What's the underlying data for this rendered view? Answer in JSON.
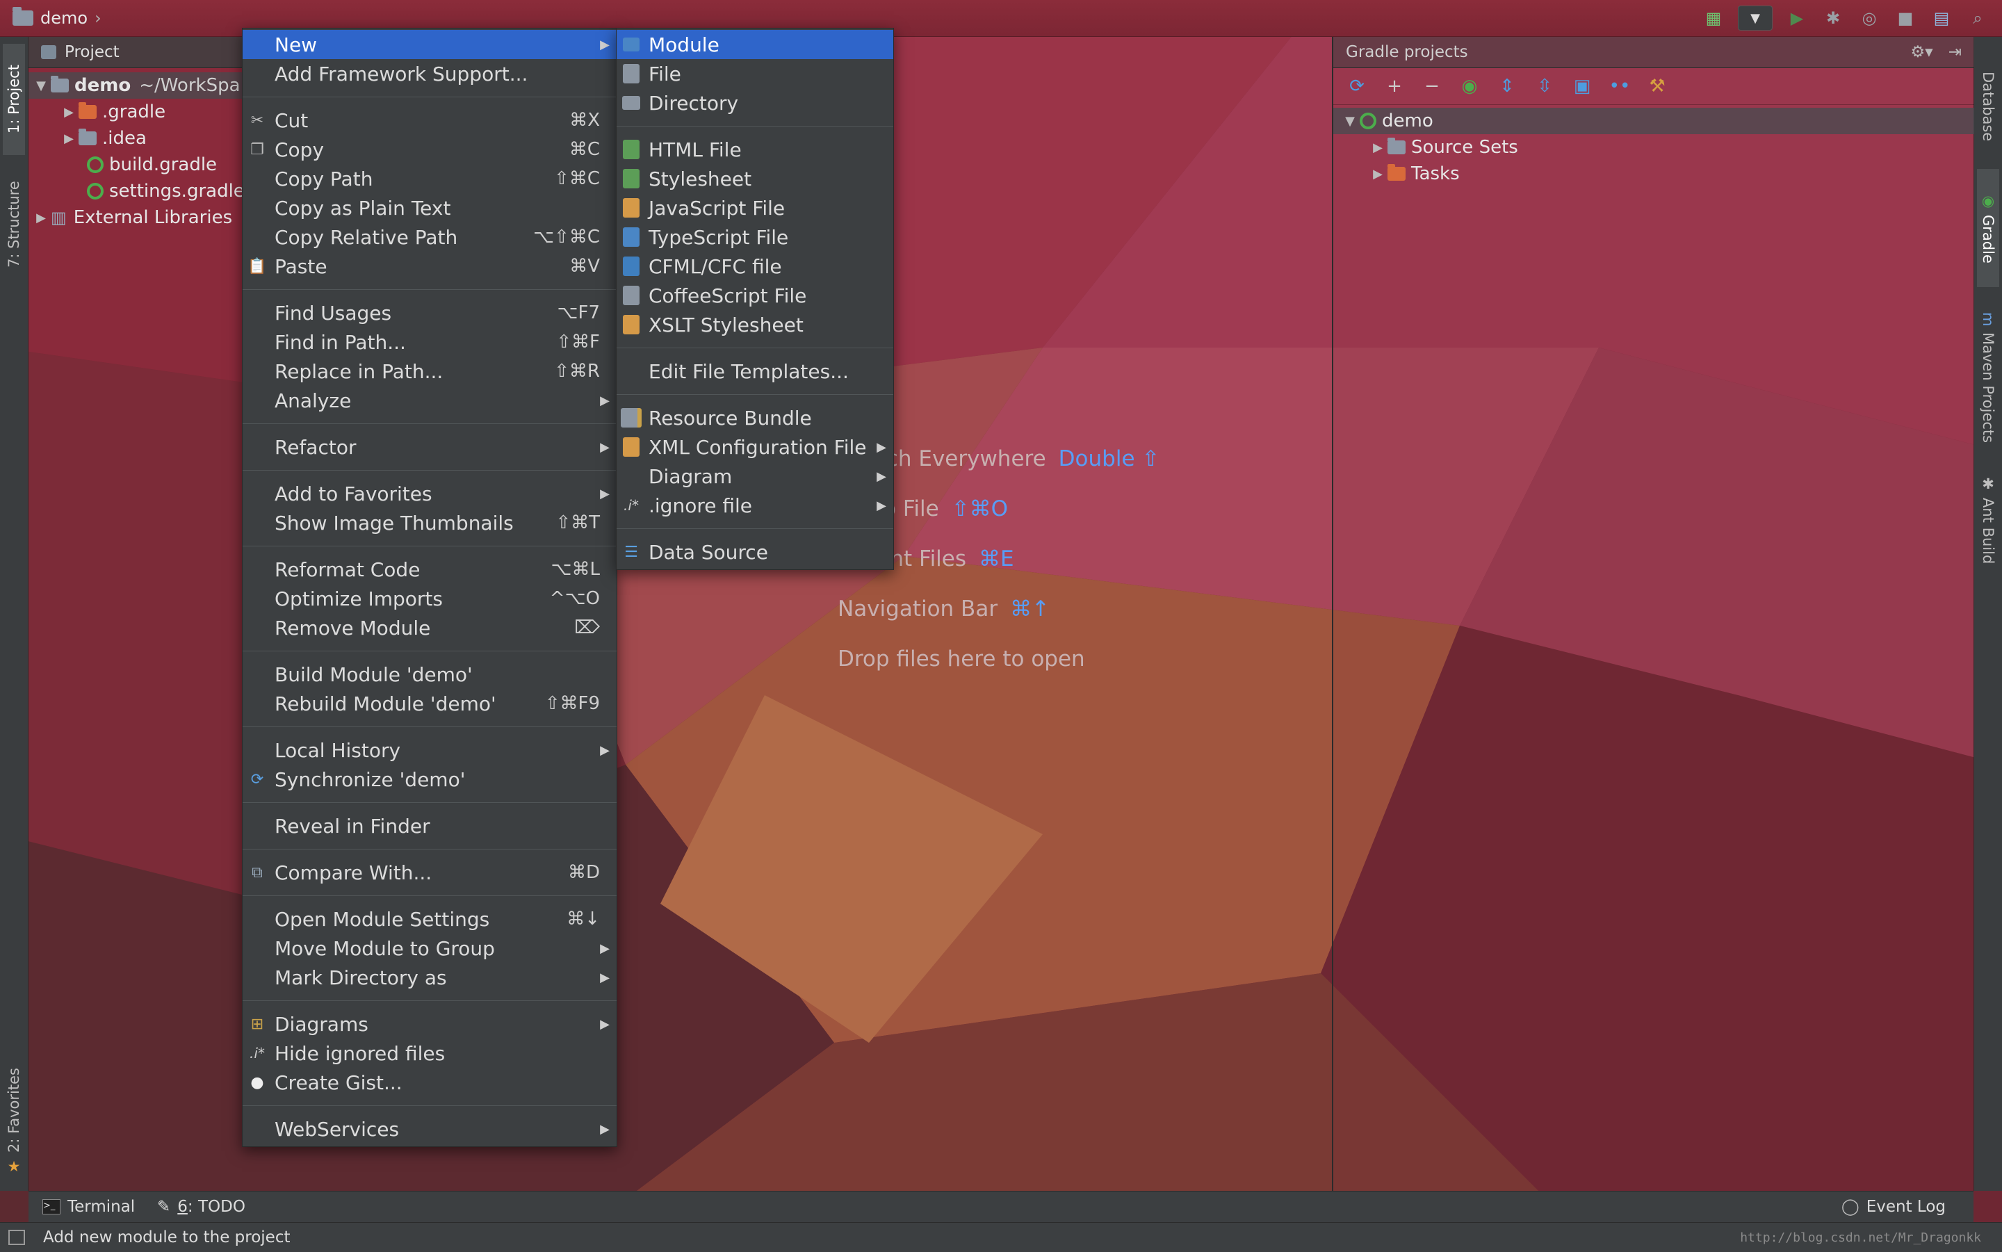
{
  "breadcrumb": "demo",
  "left_tabs": [
    "1: Project",
    "7: Structure",
    "2: Favorites"
  ],
  "right_tabs": [
    "Database",
    "Gradle",
    "Maven Projects",
    "Ant Build"
  ],
  "project_panel": {
    "title": "Project",
    "tree": [
      {
        "label": "demo",
        "suffix": "~/WorkSpa",
        "level": 0
      },
      {
        "label": ".gradle",
        "level": 1
      },
      {
        "label": ".idea",
        "level": 1
      },
      {
        "label": "build.gradle",
        "level": 1
      },
      {
        "label": "settings.gradle",
        "level": 1
      },
      {
        "label": "External Libraries",
        "level": 0
      }
    ]
  },
  "gradle_panel": {
    "title": "Gradle projects",
    "tree": [
      {
        "label": "demo"
      },
      {
        "label": "Source Sets"
      },
      {
        "label": "Tasks"
      }
    ]
  },
  "editor_hints": [
    {
      "label": "Search Everywhere",
      "key": "Double ⇧"
    },
    {
      "label": "Go to File",
      "key": "⇧⌘O"
    },
    {
      "label": "Recent Files",
      "key": "⌘E"
    },
    {
      "label": "Navigation Bar",
      "key": "⌘↑"
    },
    {
      "label": "Drop files here to open",
      "key": ""
    }
  ],
  "context_menu": {
    "items": [
      {
        "label": "New",
        "shortcut": "",
        "submenu": true
      },
      {
        "label": "Add Framework Support...",
        "shortcut": ""
      },
      {
        "label": "Cut",
        "shortcut": "⌘X"
      },
      {
        "label": "Copy",
        "shortcut": "⌘C"
      },
      {
        "label": "Copy Path",
        "shortcut": "⇧⌘C"
      },
      {
        "label": "Copy as Plain Text",
        "shortcut": ""
      },
      {
        "label": "Copy Relative Path",
        "shortcut": "⌥⇧⌘C"
      },
      {
        "label": "Paste",
        "shortcut": "⌘V"
      },
      {
        "label": "Find Usages",
        "shortcut": "⌥F7"
      },
      {
        "label": "Find in Path...",
        "shortcut": "⇧⌘F"
      },
      {
        "label": "Replace in Path...",
        "shortcut": "⇧⌘R"
      },
      {
        "label": "Analyze",
        "shortcut": "",
        "submenu": true
      },
      {
        "label": "Refactor",
        "shortcut": "",
        "submenu": true
      },
      {
        "label": "Add to Favorites",
        "shortcut": "",
        "submenu": true
      },
      {
        "label": "Show Image Thumbnails",
        "shortcut": "⇧⌘T"
      },
      {
        "label": "Reformat Code",
        "shortcut": "⌥⌘L"
      },
      {
        "label": "Optimize Imports",
        "shortcut": "^⌥O"
      },
      {
        "label": "Remove Module",
        "shortcut": "⌦"
      },
      {
        "label": "Build Module 'demo'",
        "shortcut": ""
      },
      {
        "label": "Rebuild Module 'demo'",
        "shortcut": "⇧⌘F9"
      },
      {
        "label": "Local History",
        "shortcut": "",
        "submenu": true
      },
      {
        "label": "Synchronize 'demo'",
        "shortcut": ""
      },
      {
        "label": "Reveal in Finder",
        "shortcut": ""
      },
      {
        "label": "Compare With...",
        "shortcut": "⌘D"
      },
      {
        "label": "Open Module Settings",
        "shortcut": "⌘↓"
      },
      {
        "label": "Move Module to Group",
        "shortcut": "",
        "submenu": true
      },
      {
        "label": "Mark Directory as",
        "shortcut": "",
        "submenu": true
      },
      {
        "label": "Diagrams",
        "shortcut": "",
        "submenu": true
      },
      {
        "label": "Hide ignored files",
        "shortcut": ""
      },
      {
        "label": "Create Gist...",
        "shortcut": ""
      },
      {
        "label": "WebServices",
        "shortcut": "",
        "submenu": true
      }
    ]
  },
  "new_submenu": {
    "items": [
      {
        "label": "Module"
      },
      {
        "label": "File"
      },
      {
        "label": "Directory"
      },
      {
        "label": "HTML File"
      },
      {
        "label": "Stylesheet"
      },
      {
        "label": "JavaScript File"
      },
      {
        "label": "TypeScript File"
      },
      {
        "label": "CFML/CFC file"
      },
      {
        "label": "CoffeeScript File"
      },
      {
        "label": "XSLT Stylesheet"
      },
      {
        "label": "Edit File Templates..."
      },
      {
        "label": "Resource Bundle"
      },
      {
        "label": "XML Configuration File",
        "submenu": true
      },
      {
        "label": "Diagram",
        "submenu": true
      },
      {
        "label": ".ignore file",
        "submenu": true
      },
      {
        "label": "Data Source"
      }
    ]
  },
  "bottom_tabs": {
    "terminal": "Terminal",
    "todo_num": "6",
    "todo": ": TODO",
    "event_log": "Event Log"
  },
  "status": {
    "message": "Add new module to the project",
    "watermark": "http://blog.csdn.net/Mr_Dragonkk"
  },
  "colors": {
    "menu_bg": "#3c3f41",
    "highlight": "#2f65ca",
    "accent_blue": "#589df6",
    "gradle_green": "#4cae4c"
  }
}
